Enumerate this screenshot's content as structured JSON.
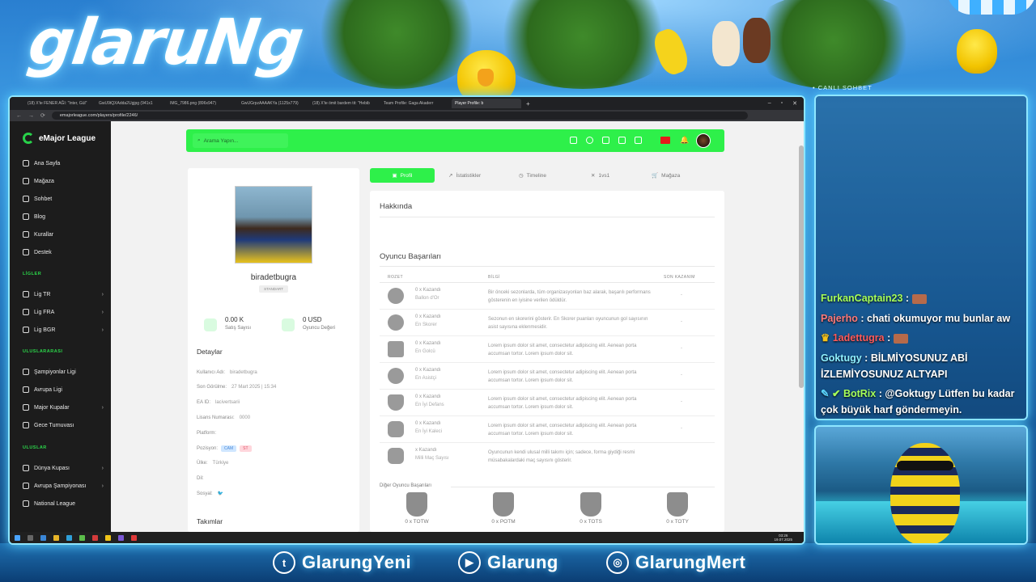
{
  "overlay": {
    "logo": "glaruNg",
    "chat_header": "• CANLI SOHBET",
    "chat_messages": [
      {
        "user": "FurkanCaptain23",
        "color": "#a6ff5a",
        "text": ""
      },
      {
        "user": "Pajerho",
        "color": "#ff7a7a",
        "text": "chati okumuyor mu bunlar aw"
      },
      {
        "user": "1adettugra",
        "color": "#ff5a5a",
        "text": ""
      },
      {
        "user": "Goktugy",
        "color": "#8ff0ff",
        "text": "BİLMİYOSUNUZ ABİ İZLEMİYOSUNUZ ALTYAPI"
      },
      {
        "user": "BotRix",
        "color": "#a6ff5a",
        "text": "@Goktugy Lütfen bu kadar çok büyük harf göndermeyin."
      }
    ],
    "socials": [
      {
        "icon": "twitter-icon",
        "handle": "GlarungYeni"
      },
      {
        "icon": "youtube-icon",
        "handle": "Glarung"
      },
      {
        "icon": "instagram-icon",
        "handle": "GlarungMert"
      }
    ]
  },
  "browser": {
    "tabs": [
      "(18) X'te FENER AĞI: \"Inter, Gül\"",
      "GwU9tQXAdda2Ugjpg (941x1",
      "IMG_7986.png (896x947)",
      "GwUGrpzAAAAKYa (1125x779)",
      "(18) X'te ömit bardem tit: \"Hebib",
      "Team Profile: Gaga Akaderr",
      "Player Profile: b"
    ],
    "url": "emajorleague.com/players/profile/2246/"
  },
  "site": {
    "brand": "eMajor League",
    "search_placeholder": "Arama Yapın...",
    "nav": {
      "main": [
        "Ana Sayfa",
        "Mağaza",
        "Sohbet",
        "Blog",
        "Kurallar",
        "Destek"
      ],
      "ligler_title": "LİGLER",
      "ligler": [
        "Lig TR",
        "Lig FRA",
        "Lig BGR"
      ],
      "uluslararasi_title": "ULUSLARARASI",
      "uluslararasi": [
        "Şampiyonlar Ligi",
        "Avrupa Ligi",
        "Major Kupalar",
        "Gece Turnuvası"
      ],
      "uluslar_title": "ULUSLAR",
      "uluslar": [
        "Dünya Kupası",
        "Avrupa Şampiyonası",
        "National League"
      ]
    }
  },
  "profile": {
    "username": "biradetbugra",
    "badge": "STANDART",
    "sales_value": "0.00 K",
    "sales_label": "Satış Sayısı",
    "player_value": "0 USD",
    "player_label": "Oyuncu Değeri",
    "details_title": "Detaylar",
    "details": [
      {
        "label": "Kullanıcı Adı:",
        "value": "biradetbugra"
      },
      {
        "label": "Son Görülme:",
        "value": "27 Mart 2025 | 15:34"
      },
      {
        "label": "EA ID:",
        "value": "lacivertsarii"
      },
      {
        "label": "Lisans Numarası:",
        "value": "0000"
      },
      {
        "label": "Platform:",
        "value": ""
      },
      {
        "label": "Pozisyon:",
        "value": ""
      },
      {
        "label": "Ülke:",
        "value": "Türkiye"
      },
      {
        "label": "Dil:",
        "value": ""
      },
      {
        "label": "Sosyal:",
        "value": ""
      }
    ],
    "positions": [
      "CAM",
      "ST"
    ],
    "teams_title": "Takımlar"
  },
  "tabs": [
    "Profil",
    "İstatistikler",
    "Timeline",
    "1vs1",
    "Mağaza"
  ],
  "about_title": "Hakkında",
  "achievements": {
    "title": "Oyuncu Başarıları",
    "columns": [
      "ROZET",
      "BİLGİ",
      "SON KAZANIM"
    ],
    "rows": [
      {
        "count": "0 x Kazandı",
        "title": "Ballon d'Or",
        "info": "Bir önceki sezonlarda, tüm organizasyonları baz alarak, başarılı performans gösterenin en iyisine verilen ödüldür.",
        "last": "-"
      },
      {
        "count": "0 x Kazandı",
        "title": "En Skorer",
        "info": "Sezonun en skorerini gösterir. En Skorer puanları oyuncunun gol sayısının asist sayısına eklenmesidir.",
        "last": "-"
      },
      {
        "count": "0 x Kazandı",
        "title": "En Golcü",
        "info": "Lorem ipsum dolor sit amet, consectetur adipiscing elit. Aenean porta accumsan tortor. Lorem ipsum dolor sit.",
        "last": "-"
      },
      {
        "count": "0 x Kazandı",
        "title": "En Asistçi",
        "info": "Lorem ipsum dolor sit amet, consectetur adipiscing elit. Aenean porta accumsan tortor. Lorem ipsum dolor sit.",
        "last": "-"
      },
      {
        "count": "0 x Kazandı",
        "title": "En İyi Defans",
        "info": "Lorem ipsum dolor sit amet, consectetur adipiscing elit. Aenean porta accumsan tortor. Lorem ipsum dolor sit.",
        "last": "-"
      },
      {
        "count": "0 x Kazandı",
        "title": "En İyi Kaleci",
        "info": "Lorem ipsum dolor sit amet, consectetur adipiscing elit. Aenean porta accumsan tortor. Lorem ipsum dolor sit.",
        "last": "-"
      },
      {
        "count": "x Kazandı",
        "title": "Milli Maç Sayısı",
        "info": "Oyuncunun kendi ulusal milli takımı için; sadece, forma giydiği resmi müsabakalardaki maç sayısını gösterir.",
        "last": ""
      }
    ],
    "other_title": "Diğer Oyuncu Başarıları",
    "other": [
      "0 x TOTW",
      "0 x POTM",
      "0 x TOTS",
      "0 x TOTY"
    ]
  },
  "taskbar": {
    "time": "03:26",
    "date": "19.07.2025"
  }
}
